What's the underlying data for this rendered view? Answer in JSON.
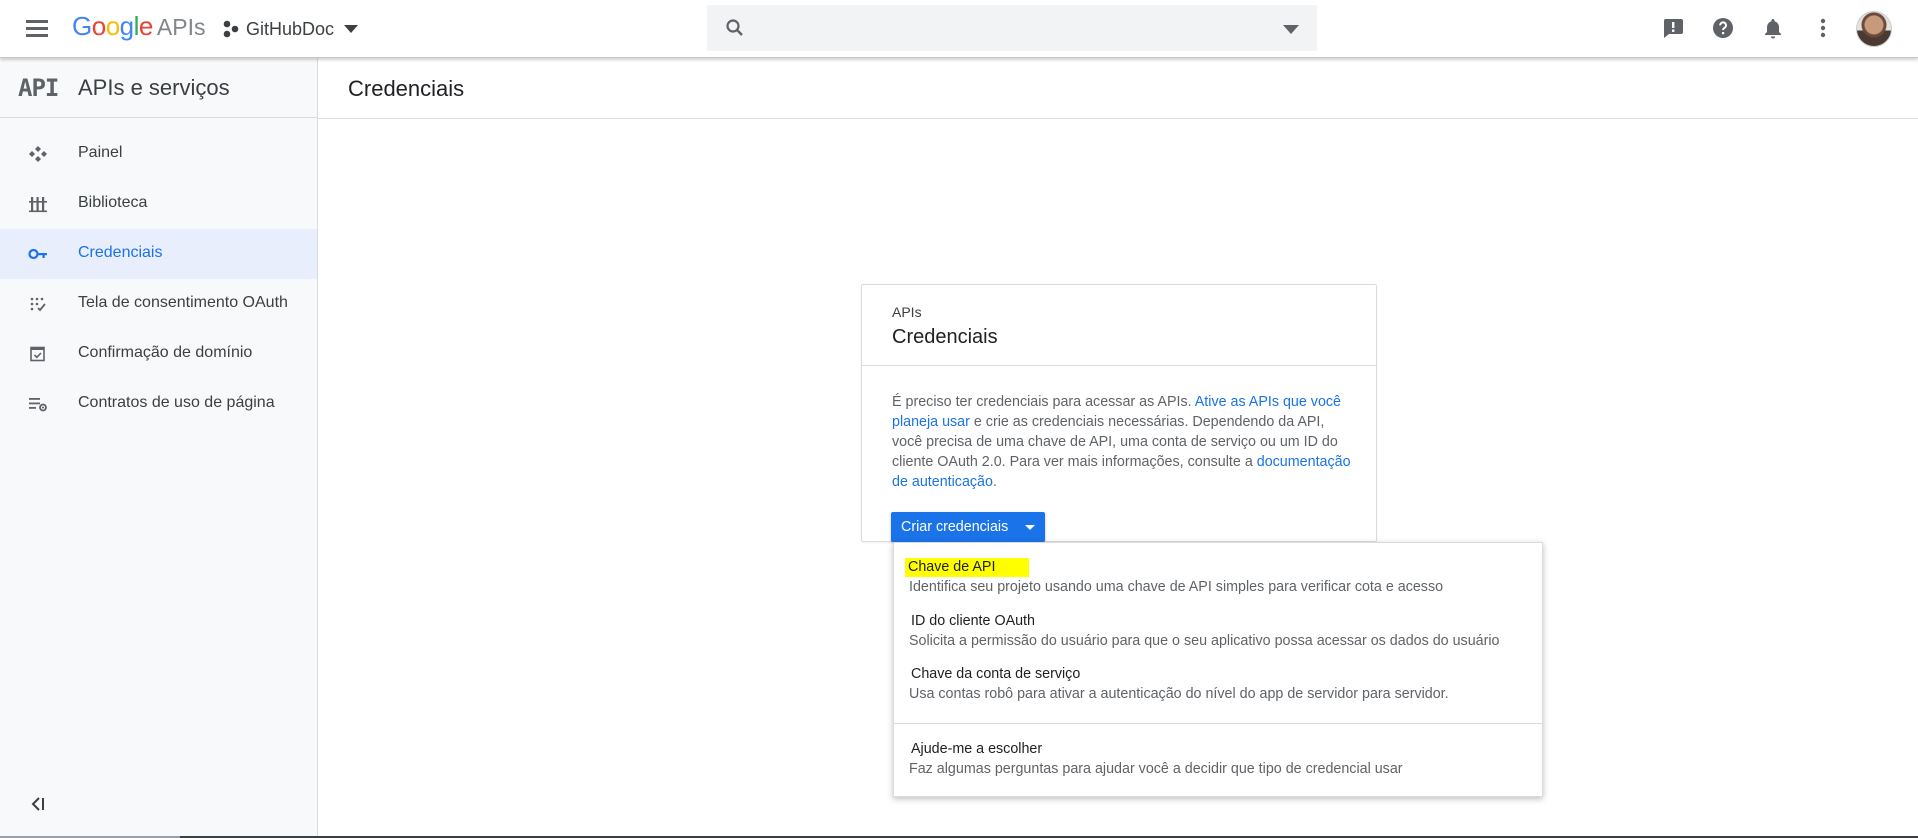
{
  "header": {
    "logo_text": "Google",
    "logo_suffix": "APIs",
    "project_name": "GitHubDoc",
    "search_placeholder": ""
  },
  "sidebar": {
    "logo_mark": "API",
    "title": "APIs e serviços",
    "items": [
      {
        "label": "Painel",
        "icon": "dashboard-icon"
      },
      {
        "label": "Biblioteca",
        "icon": "library-icon"
      },
      {
        "label": "Credenciais",
        "icon": "key-icon",
        "active": true
      },
      {
        "label": "Tela de consentimento OAuth",
        "icon": "oauth-consent-icon"
      },
      {
        "label": "Confirmação de domínio",
        "icon": "domain-verification-icon"
      },
      {
        "label": "Contratos de uso de página",
        "icon": "page-usage-agreements-icon"
      }
    ]
  },
  "main": {
    "page_title": "Credenciais"
  },
  "card": {
    "subtitle": "APIs",
    "title": "Credenciais",
    "text_1": "É preciso ter credenciais para acessar as APIs. ",
    "link_1": "Ative as APIs que você planeja usar",
    "text_2": " e crie as credenciais necessárias. Dependendo da API, você precisa de uma chave de API, uma conta de serviço ou um ID do cliente OAuth 2.0. Para ver mais informações, consulte a ",
    "link_2": "documentação de autenticação",
    "text_3": ".",
    "button_label": "Criar credenciais"
  },
  "menu": {
    "items": [
      {
        "title": "Chave de API",
        "desc": "Identifica seu projeto usando uma chave de API simples para verificar cota e acesso",
        "highlighted": true
      },
      {
        "title": "ID do cliente OAuth",
        "desc": "Solicita a permissão do usuário para que o seu aplicativo possa acessar os dados do usuário"
      },
      {
        "title": "Chave da conta de serviço",
        "desc": "Usa contas robô para ativar a autenticação do nível do app de servidor para servidor."
      },
      {
        "title": "Ajude-me a escolher",
        "desc": "Faz algumas perguntas para ajudar você a decidir que tipo de credencial usar"
      }
    ]
  },
  "colors": {
    "accent": "#1a73e8",
    "highlight": "#ffff00"
  }
}
